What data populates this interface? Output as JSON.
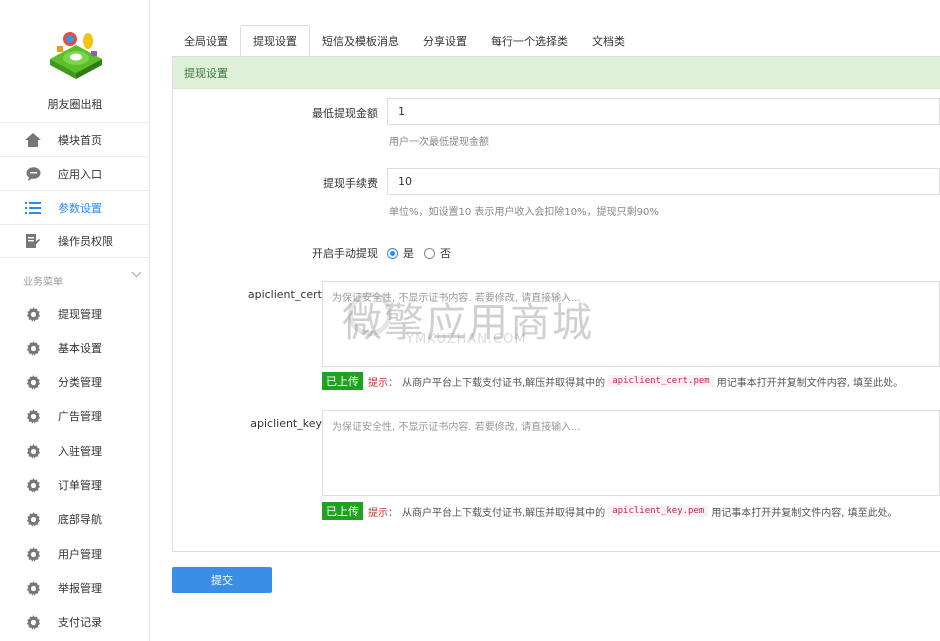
{
  "app": {
    "name": "朋友圈出租"
  },
  "nav": [
    {
      "label": "模块首页",
      "icon": "home-icon",
      "active": false
    },
    {
      "label": "应用入口",
      "icon": "chat-bubble-icon",
      "active": false
    },
    {
      "label": "参数设置",
      "icon": "list-settings-icon",
      "active": true
    },
    {
      "label": "操作员权限",
      "icon": "document-edit-icon",
      "active": false
    }
  ],
  "business_menu": {
    "title": "业务菜单",
    "items": [
      {
        "label": "提现管理",
        "icon": "gear-icon"
      },
      {
        "label": "基本设置",
        "icon": "gear-icon"
      },
      {
        "label": "分类管理",
        "icon": "gear-icon"
      },
      {
        "label": "广告管理",
        "icon": "gear-icon"
      },
      {
        "label": "入驻管理",
        "icon": "gear-icon"
      },
      {
        "label": "订单管理",
        "icon": "gear-icon"
      },
      {
        "label": "底部导航",
        "icon": "gear-icon"
      },
      {
        "label": "用户管理",
        "icon": "gear-icon"
      },
      {
        "label": "举报管理",
        "icon": "gear-icon"
      },
      {
        "label": "支付记录",
        "icon": "gear-icon"
      }
    ]
  },
  "tabs": [
    {
      "label": "全局设置",
      "active": false
    },
    {
      "label": "提现设置",
      "active": true
    },
    {
      "label": "短信及模板消息",
      "active": false
    },
    {
      "label": "分享设置",
      "active": false
    },
    {
      "label": "每行一个选择类",
      "active": false
    },
    {
      "label": "文档类",
      "active": false
    }
  ],
  "panel": {
    "title": "提现设置",
    "min_withdraw": {
      "label": "最低提现金额",
      "value": "1",
      "help": "用户一次最低提现金额"
    },
    "fee": {
      "label": "提现手续费",
      "value": "10",
      "help": "单位%，如设置10 表示用户收入会扣除10%，提现只剩90%"
    },
    "manual": {
      "label": "开启手动提现",
      "yes": "是",
      "no": "否",
      "selected": "yes"
    },
    "cert": {
      "label": "apiclient_cert",
      "placeholder": "为保证安全性, 不显示证书内容. 若要修改, 请直接输入...",
      "badge": "已上传",
      "hint_label": "提示：",
      "hint_pre": "从商户平台上下载支付证书,解压并取得其中的",
      "filename": "apiclient_cert.pem",
      "hint_post": "用记事本打开并复制文件内容, 填至此处。"
    },
    "key": {
      "label": "apiclient_key",
      "placeholder": "为保证安全性, 不显示证书内容. 若要修改, 请直接输入...",
      "badge": "已上传",
      "hint_label": "提示：",
      "hint_pre": "从商户平台上下载支付证书,解压并取得其中的",
      "filename": "apiclient_key.pem",
      "hint_post": "用记事本打开并复制文件内容, 填至此处。"
    }
  },
  "submit_label": "提交",
  "watermark": {
    "text": "微擎应用商城",
    "sub": "YMKUZHAN.COM"
  },
  "colors": {
    "accent": "#2e8ae6",
    "panel_head_bg": "#dff0d8",
    "badge_green": "#22a022",
    "hint_red": "#c9302c"
  }
}
